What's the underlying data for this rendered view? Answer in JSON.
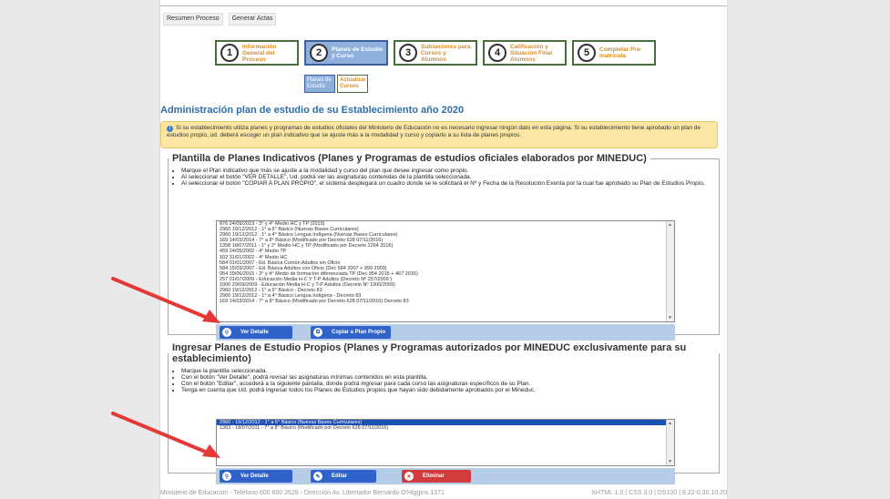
{
  "topnav": {
    "item1": "Resumen Proceso",
    "item2": "Generar Actas"
  },
  "steps": [
    {
      "num": "1",
      "label": "Información General del Proceso"
    },
    {
      "num": "2",
      "label": "Planes de Estudio y Curso"
    },
    {
      "num": "3",
      "label": "Subsectores para Cursos y Alumnos"
    },
    {
      "num": "4",
      "label": "Calificación y Situación Final Alumnos"
    },
    {
      "num": "5",
      "label": "Completar Pre-matrícula"
    }
  ],
  "subtabs": {
    "planes": "Planes de Estudio",
    "actualizar": "Actualizar Cursos"
  },
  "page_title": "Administración plan de estudio de su Establecimiento año 2020",
  "info_text": "Si su establecimiento utiliza planes y programas de estudios oficiales del Ministerio de Educación no es necesario ingresar ningún dato en esta página. Si su establecimiento tiene aprobado un plan de estudios propio, ud. deberá escoger un plan indicativo que se ajuste más a la modalidad y curso y copiarlo a su lista de planes propios.",
  "section1": {
    "legend": "Plantilla de Planes Indicativos (Planes y Programas de estudios oficiales elaborados por MINEDUC)",
    "bullets": [
      "Marque el Plan indicativo que más se ajuste a la modalidad y curso del plan que desee ingresar como propio.",
      "Al seleccionar el botón \"VER DETALLE\", Ud. podrá ver las asignaturas contenidas de la plantilla seleccionada.",
      "Al seleccionar el botón \"COPIAR A PLAN PROPIO\", el sistema desplegará un cuadro donde se le solicitará el Nº y Fecha de la Resolución Exenta por la cual fue aprobado su Plan de Estudios Propio."
    ],
    "list": [
      "876  24/09/2019  -  3° y 4° Medio HC y TP (2019)",
      "2960  19/12/2012  -  1° a 6° Básico (Nuevas Bases Curriculares)",
      "2960  19/12/2012  -  1° a 4° Básico Lengua Indígena (Nuevas Bases Curriculares)",
      "169  14/03/2014  -  7° a 8° Básico (Modificado por Decreto 628 07/11/2016)",
      "1358  18/07/2011  -  1° y 2° Medio HC y TP (Modificado por Decreto 1264 2016)",
      "459  24/05/2002  -  4° Medio TP",
      "102  31/01/2002  -  4° Medio HC",
      "584  01/01/2007  -  Ed. Básica Común Adultos sin Oficio",
      "584  15/03/2007  -  Ed. Básica Adultos con Oficio (Dec 584 2007 + 999 2009)",
      "954  29/06/2015  -  3° y 4° Medio de formación diferenciada TP (Dec 954 2015 + 467 2016)",
      "257  01/07/2009  -  Educación Media H-C Y T-P Adultos (Decreto Nº 257/2009 )",
      "1000  29/09/2009  -  Educación Media H-C y T-P Adultos (Decreto Nº 1000/2009)",
      "2960  19/12/2012  -  1° a 6° Básico - Decreto 83",
      "2960  19/12/2012  -  1° a 4° Básico Lengua Indígena - Decreto 83",
      "169  14/03/2014  -  7° a 8° Básico (Modificado por Decreto 628 07/11/2016) Decreto 83"
    ],
    "btn_detalle": "Ver Detalle",
    "btn_copiar": "Copiar a Plan Propio"
  },
  "section2": {
    "legend": "Ingresar Planes de Estudio Propios (Planes y Programas autorizados por MINEDUC exclusivamente para su establecimiento)",
    "bullets": [
      "Marque la plantilla seleccionada.",
      "Con el botón \"Ver Detalle\", podrá revisar las asignaturas mínimas contenidos en esta plantilla.",
      "Con el botón \"Editar\", accederá a la siguiente pantalla, donde podrá ingresar para cada curso las asignaturas específicos de su Plan.",
      "Tenga en cuenta que Ud. podrá ingresar todos los Planes de Estudios propios que hayan sido debidamente aprobados por el Mineduc."
    ],
    "list": [
      "2960 - 19/12/2012  -  1° a 6° Básico (Nuevas Bases Curriculares)",
      "1363 - 18/07/2011  -  7° a 8° Básico (Modificado por Decreto 628 07/11/2016)"
    ],
    "btn_detalle": "Ver Detalle",
    "btn_editar": "Editar",
    "btn_eliminar": "Eliminar"
  },
  "footer": {
    "left": "Ministerio de Educación - Teléfono 600 600 2626 - Dirección Av. Libertador Bernardo O'Higgins 1371",
    "right": "XHTML 1.0 | CSS 3.0 | DS100 | 8.22-0.30.10.20"
  },
  "colors": {
    "accent": "#2f63c9",
    "arrow": "#e53935",
    "title": "#2f6ea5",
    "info_bg": "#fbe6a4"
  }
}
